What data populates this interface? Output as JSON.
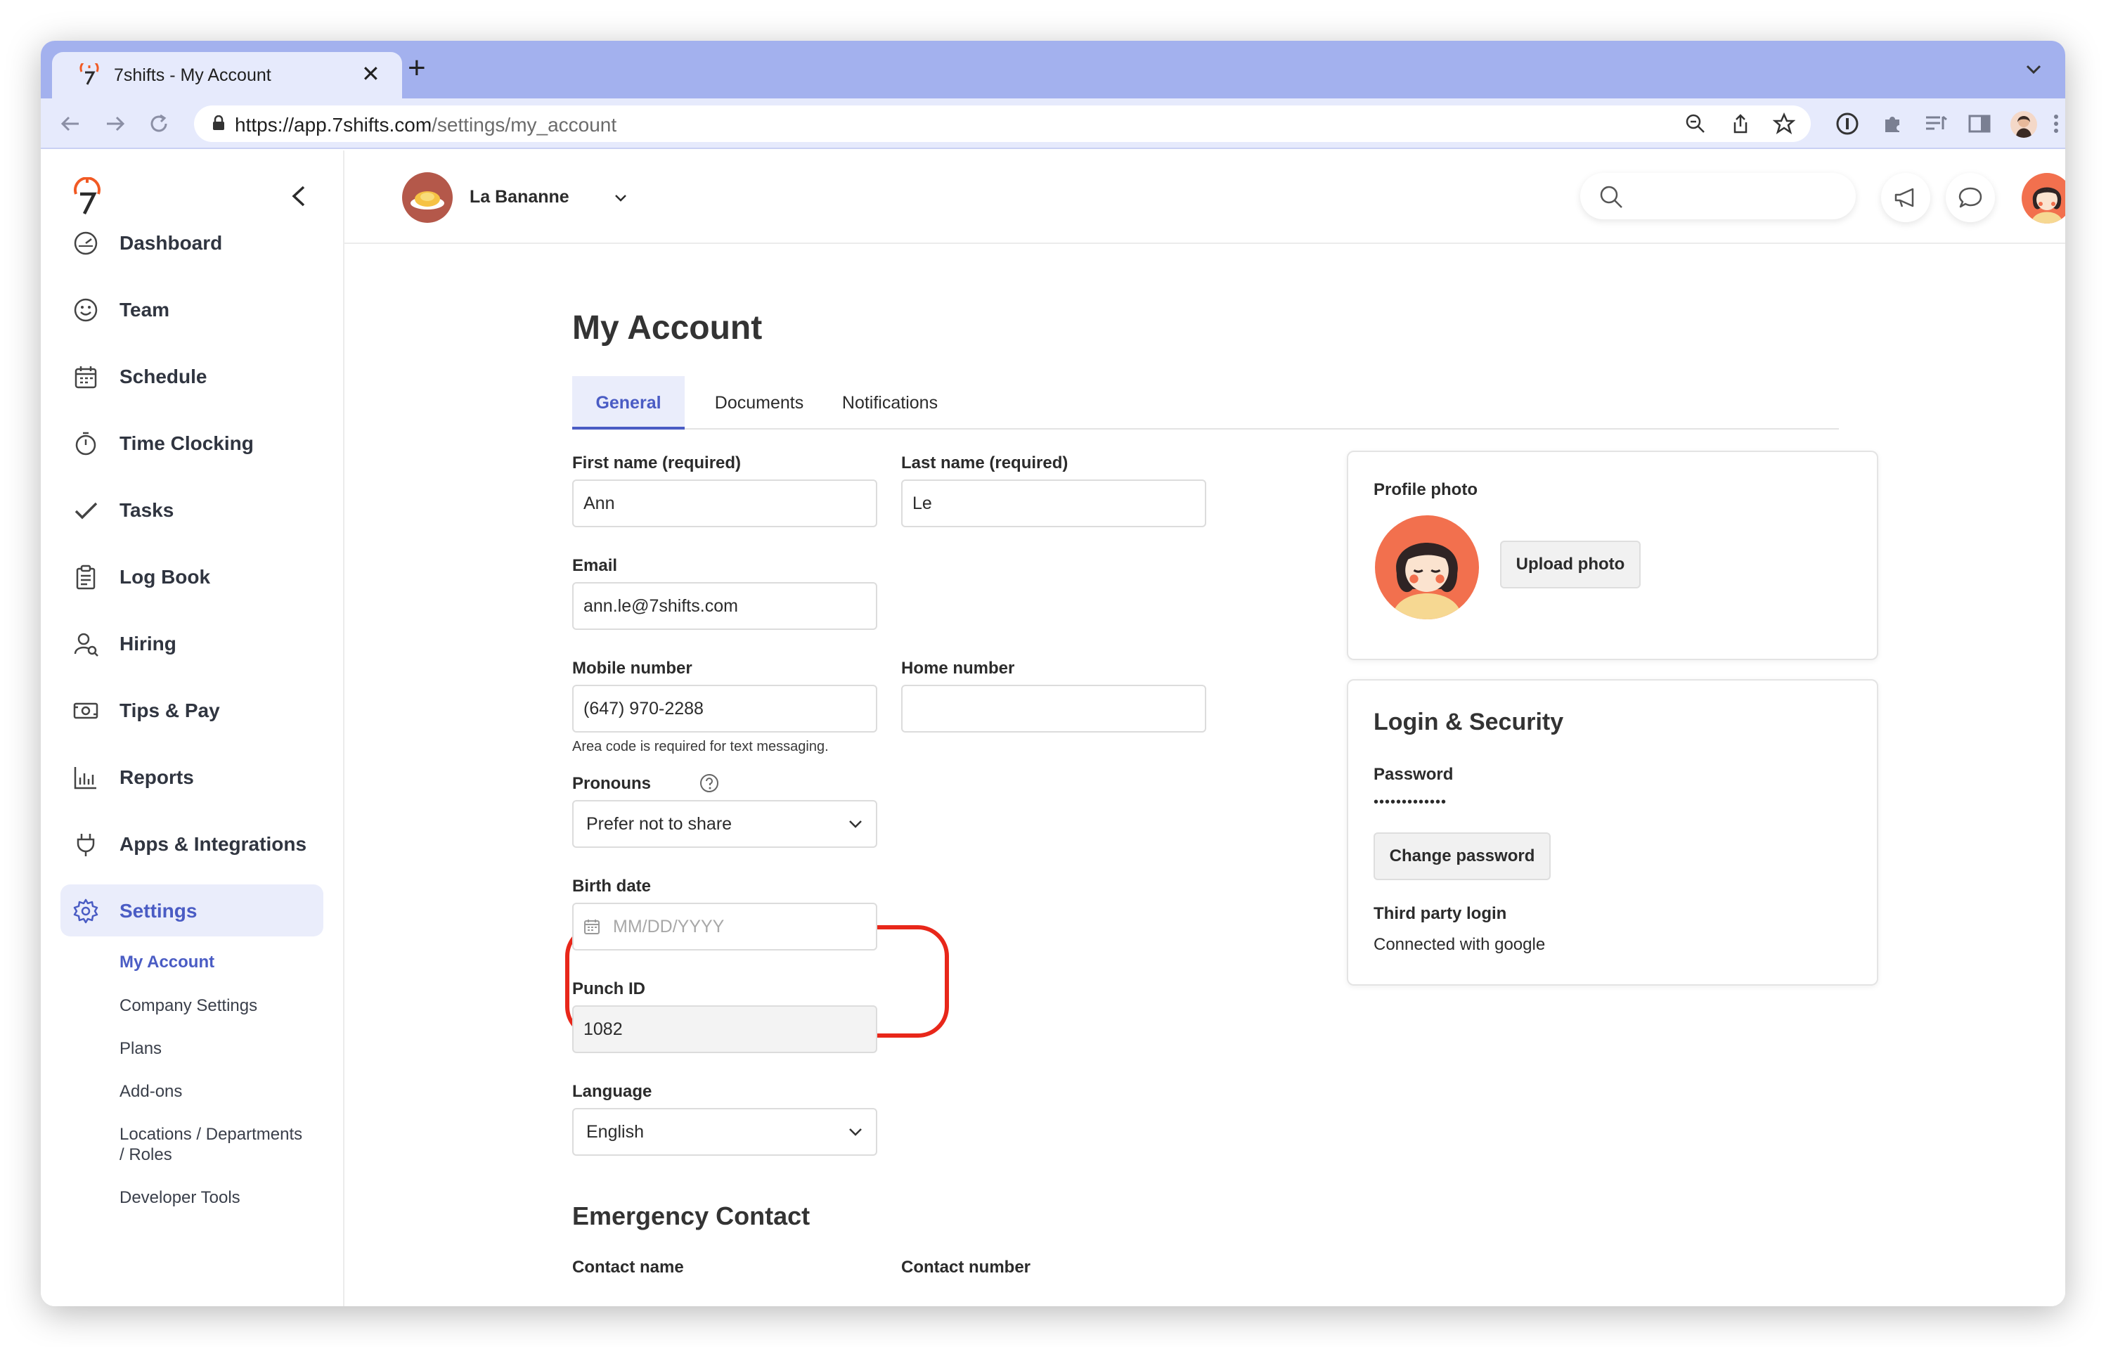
{
  "browser": {
    "tab_title": "7shifts - My Account",
    "tab_close": "✕",
    "new_tab": "+",
    "url_host": "https://app.7shifts.com",
    "url_path": "/settings/my_account"
  },
  "sidebar": {
    "items": [
      {
        "label": "Dashboard",
        "icon": "dashboard-icon"
      },
      {
        "label": "Team",
        "icon": "team-icon"
      },
      {
        "label": "Schedule",
        "icon": "calendar-icon"
      },
      {
        "label": "Time Clocking",
        "icon": "stopwatch-icon"
      },
      {
        "label": "Tasks",
        "icon": "checkmark-icon"
      },
      {
        "label": "Log Book",
        "icon": "clipboard-icon"
      },
      {
        "label": "Hiring",
        "icon": "hiring-icon"
      },
      {
        "label": "Tips & Pay",
        "icon": "money-icon"
      },
      {
        "label": "Reports",
        "icon": "bar-chart-icon"
      },
      {
        "label": "Apps & Integrations",
        "icon": "plug-icon"
      },
      {
        "label": "Settings",
        "icon": "gear-icon"
      }
    ],
    "sub_items": [
      {
        "label": "My Account"
      },
      {
        "label": "Company Settings"
      },
      {
        "label": "Plans"
      },
      {
        "label": "Add-ons"
      },
      {
        "label": "Locations / Departments"
      },
      {
        "label": "/ Roles"
      },
      {
        "label": "Developer Tools"
      }
    ]
  },
  "header": {
    "location_name": "La Bananne",
    "search_placeholder": ""
  },
  "page": {
    "title": "My Account",
    "tabs": [
      {
        "label": "General"
      },
      {
        "label": "Documents"
      },
      {
        "label": "Notifications"
      }
    ],
    "active_tab": "General"
  },
  "form": {
    "first_name": {
      "label": "First name (required)",
      "value": "Ann"
    },
    "last_name": {
      "label": "Last name (required)",
      "value": "Le"
    },
    "email": {
      "label": "Email",
      "value": "ann.le@7shifts.com"
    },
    "mobile": {
      "label": "Mobile number",
      "value": "(647) 970-2288",
      "hint": "Area code is required for text messaging."
    },
    "home": {
      "label": "Home number",
      "value": ""
    },
    "pronouns": {
      "label": "Pronouns",
      "value": "Prefer not to share"
    },
    "birth_date": {
      "label": "Birth date",
      "placeholder": "MM/DD/YYYY"
    },
    "punch_id": {
      "label": "Punch ID",
      "value": "1082"
    },
    "language": {
      "label": "Language",
      "value": "English"
    }
  },
  "emergency": {
    "title": "Emergency Contact",
    "contact_name_label": "Contact name",
    "contact_number_label": "Contact number"
  },
  "profile_card": {
    "label": "Profile photo",
    "upload_button": "Upload photo"
  },
  "security_card": {
    "title": "Login & Security",
    "password_label": "Password",
    "password_mask": "•••••••••••••",
    "change_button": "Change password",
    "third_party_label": "Third party login",
    "third_party_value": "Connected with google"
  },
  "colors": {
    "accent": "#4a5cc4",
    "highlight": "#e8271a",
    "brand_orange": "#f2704e",
    "fab": "#5d79df"
  }
}
